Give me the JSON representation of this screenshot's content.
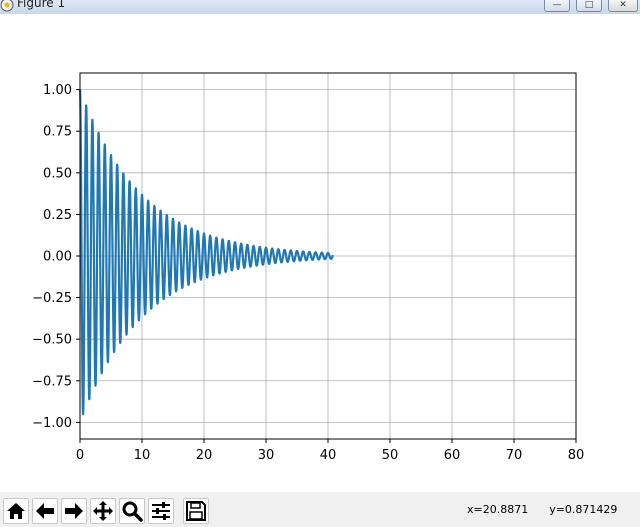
{
  "window": {
    "title": "Figure 1",
    "min_glyph": "—",
    "max_glyph": "□",
    "close_glyph": "✕"
  },
  "toolbar": {
    "tools": [
      "home-icon",
      "back-icon",
      "forward-icon",
      "pan-icon",
      "zoom-icon",
      "configure-subplots-icon",
      "save-icon"
    ],
    "status_x": "x=20.8871",
    "status_y": "y=0.871429"
  },
  "chart_data": {
    "type": "line",
    "title": "",
    "xlabel": "",
    "ylabel": "",
    "xlim": [
      0,
      80
    ],
    "ylim": [
      -1.1,
      1.1
    ],
    "xticks": [
      0,
      10,
      20,
      30,
      40,
      50,
      60,
      70,
      80
    ],
    "yticks": [
      -1.0,
      -0.75,
      -0.5,
      -0.25,
      0.0,
      0.25,
      0.5,
      0.75,
      1.0
    ],
    "xtick_labels": [
      "0",
      "10",
      "20",
      "30",
      "40",
      "50",
      "60",
      "70",
      "80"
    ],
    "ytick_labels": [
      "−1.00",
      "−0.75",
      "−0.50",
      "−0.25",
      "0.00",
      "0.25",
      "0.50",
      "0.75",
      "1.00"
    ],
    "grid": true,
    "series_color": "#1f77b4",
    "series": [
      {
        "function": "damped_cosine",
        "amplitude": 1.0,
        "decay_rate": 0.1,
        "period": 1.0,
        "x_start": 0,
        "x_end": 40.8,
        "y_at_x0": 1.0,
        "envelope_at_x10": 0.37,
        "envelope_at_x20": 0.14,
        "envelope_at_x30": 0.05,
        "envelope_at_x40": 0.02
      }
    ]
  }
}
